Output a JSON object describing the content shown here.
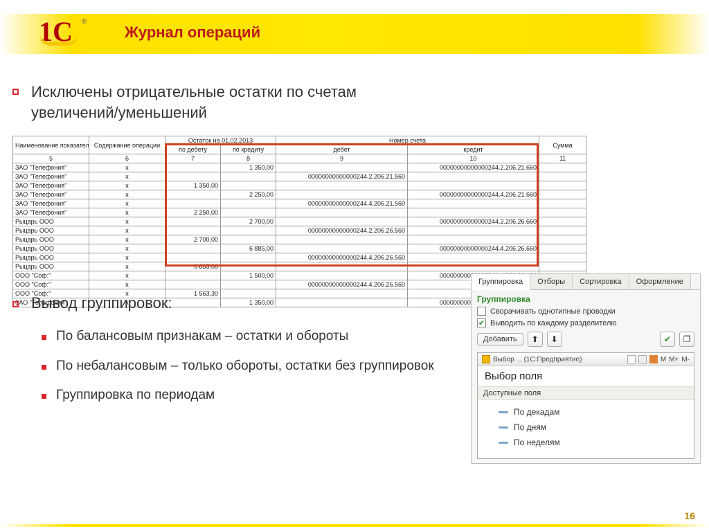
{
  "header": {
    "title": "Журнал операций"
  },
  "bullets": {
    "main1_line1": "Исключены отрицательные остатки по счетам",
    "main1_line2": "увеличений/уменьшений",
    "main2": "Вывод группировок:",
    "sub1": "По балансовым признакам – остатки и обороты",
    "sub2": "По небалансовым – только обороты, остатки без группировок",
    "sub3": "Группировка по периодам"
  },
  "table": {
    "top_header_balance": "Остаток на 01.02.2013",
    "top_header_account": "Номер счета",
    "headers": {
      "c1": "Наименование показателя",
      "c2": "Содержание операции",
      "c3": "по дебету",
      "c4": "по кредиту",
      "c5": "дебет",
      "c6": "кредит",
      "c7": "Сумма"
    },
    "numrow": {
      "c1": "5",
      "c2": "6",
      "c3": "7",
      "c4": "8",
      "c5": "9",
      "c6": "10",
      "c7": "11"
    },
    "rows": [
      {
        "name": "ЗАО \"Телефония\"",
        "op": "х",
        "deb": "",
        "cred": "1 350,00",
        "adeb": "",
        "acred": "00000000000000244.2.206.21.660",
        "sum": ""
      },
      {
        "name": "ЗАО \"Телефония\"",
        "op": "х",
        "deb": "",
        "cred": "",
        "adeb": "00000000000000244.2.206.21.560",
        "acred": "",
        "sum": ""
      },
      {
        "name": "ЗАО \"Телефония\"",
        "op": "х",
        "deb": "1 350,00",
        "cred": "",
        "adeb": "",
        "acred": "",
        "sum": ""
      },
      {
        "name": "ЗАО \"Телефония\"",
        "op": "х",
        "deb": "",
        "cred": "2 250,00",
        "adeb": "",
        "acred": "00000000000000244.4.206.21.660",
        "sum": ""
      },
      {
        "name": "ЗАО \"Телефония\"",
        "op": "х",
        "deb": "",
        "cred": "",
        "adeb": "00000000000000244.4.206.21.560",
        "acred": "",
        "sum": ""
      },
      {
        "name": "ЗАО \"Телефония\"",
        "op": "х",
        "deb": "2 250,00",
        "cred": "",
        "adeb": "",
        "acred": "",
        "sum": ""
      },
      {
        "name": "Рыцарь ООО",
        "op": "х",
        "deb": "",
        "cred": "2 700,00",
        "adeb": "",
        "acred": "00000000000000244.2.206.26.660",
        "sum": ""
      },
      {
        "name": "Рыцарь ООО",
        "op": "х",
        "deb": "",
        "cred": "",
        "adeb": "00000000000000244.2.206.26.560",
        "acred": "",
        "sum": ""
      },
      {
        "name": "Рыцарь ООО",
        "op": "х",
        "deb": "2 700,00",
        "cred": "",
        "adeb": "",
        "acred": "",
        "sum": ""
      },
      {
        "name": "Рыцарь ООО",
        "op": "х",
        "deb": "",
        "cred": "6 885,00",
        "adeb": "",
        "acred": "00000000000000244.4.206.26.660",
        "sum": ""
      },
      {
        "name": "Рыцарь ООО",
        "op": "х",
        "deb": "",
        "cred": "",
        "adeb": "00000000000000244.4.206.26.560",
        "acred": "",
        "sum": ""
      },
      {
        "name": "Рыцарь ООО",
        "op": "х",
        "deb": "6 885,00",
        "cred": "",
        "adeb": "",
        "acred": "",
        "sum": ""
      },
      {
        "name": "ООО \"Соф:\"",
        "op": "х",
        "deb": "",
        "cred": "1 500,00",
        "adeb": "",
        "acred": "00000000000000244.4.206.26.660",
        "sum": ""
      },
      {
        "name": "ООО \"Соф:\"",
        "op": "х",
        "deb": "",
        "cred": "",
        "adeb": "00000000000000244.4.206.26.560",
        "acred": "",
        "sum": ""
      },
      {
        "name": "ООО \"Соф:\"",
        "op": "х",
        "deb": "1 563,30",
        "cred": "",
        "adeb": "",
        "acred": "",
        "sum": ""
      },
      {
        "name": "ЗАО \"Телефония\"",
        "op": "х",
        "deb": "",
        "cred": "1 350,00",
        "adeb": "",
        "acred": "00000000000000244.2.302.21.730",
        "sum": ""
      }
    ]
  },
  "panel": {
    "tabs": [
      "Группировка",
      "Отборы",
      "Сортировка",
      "Оформление"
    ],
    "section_label": "Группировка",
    "chk1": "Сворачивать однотипные проводки",
    "chk2": "Выводить по каждому разделителю",
    "add_btn": "Добавить",
    "subwin_title": "Выбор ... (1С:Предприятие)",
    "subwin_head": "Выбор поля",
    "fields_label": "Доступные поля",
    "tree": [
      "По декадам",
      "По дням",
      "По неделям"
    ],
    "m_labels": {
      "m": "M",
      "mplus": "M+",
      "mminus": "M-"
    }
  },
  "page_number": "16"
}
